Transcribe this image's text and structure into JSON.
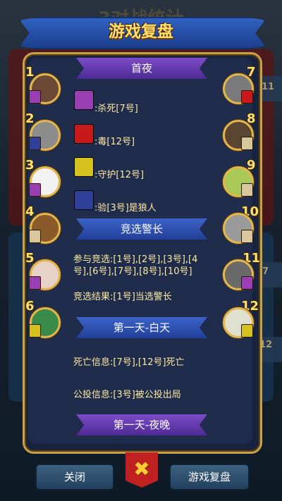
{
  "header": {
    "title": "游戏复盘"
  },
  "backdrop": {
    "title": "3对战统计",
    "side_numbers": [
      "11",
      "7",
      "12"
    ]
  },
  "sections": {
    "night1": "首夜",
    "sheriff": "竞选警长",
    "day1": "第一天-白天",
    "night2": "第一天-夜晚"
  },
  "night_actions": [
    {
      "icon_label": "狼人",
      "text": ":杀死[7号]",
      "color": "#9a3fb3"
    },
    {
      "icon_label": "女巫",
      "text": ":毒[12号]",
      "color": "#c81a1a"
    },
    {
      "icon_label": "守卫",
      "text": ":守护[12号]",
      "color": "#d6c21e"
    },
    {
      "icon_label": "预言家",
      "text": ":验[3号]是狼人",
      "color": "#2f3f9a"
    }
  ],
  "sheriff_lines": {
    "candidates": "参与竞选:[1号],[2号],[3号],[4号],[6号],[7号],[8号],[10号]",
    "candidates_line1": "参与竞选:[1号],[2号],[3号],[4",
    "candidates_line2": "号],[6号],[7号],[8号],[10号]",
    "result": "竞选结果:[1号]当选警长"
  },
  "day1_lines": {
    "death": "死亡信息:[7号],[12号]死亡",
    "vote": "公投信息:[3号]被公投出局"
  },
  "players_left": [
    {
      "num": "1",
      "avatar_color": "#6a4a36",
      "badge_color": "#9a3fb3"
    },
    {
      "num": "2",
      "avatar_color": "#8c8c8c",
      "badge_color": "#2f3f9a"
    },
    {
      "num": "3",
      "avatar_color": "#f2f2f2",
      "badge_color": "#9a3fb3"
    },
    {
      "num": "4",
      "avatar_color": "#8a5a2a",
      "badge_color": "#d8c79a"
    },
    {
      "num": "5",
      "avatar_color": "#e8d2c8",
      "badge_color": "#9a3fb3"
    },
    {
      "num": "6",
      "avatar_color": "#3a8a4a",
      "badge_color": "#d6c21e"
    }
  ],
  "players_right": [
    {
      "num": "7",
      "avatar_color": "#7a7a7a",
      "badge_color": "#c81a1a"
    },
    {
      "num": "8",
      "avatar_color": "#5a4630",
      "badge_color": "#d8c79a"
    },
    {
      "num": "9",
      "avatar_color": "#a8c858",
      "badge_color": "#d8c79a"
    },
    {
      "num": "10",
      "avatar_color": "#9a9a9a",
      "badge_color": "#d8c79a"
    },
    {
      "num": "11",
      "avatar_color": "#6a6a6a",
      "badge_color": "#9a3fb3"
    },
    {
      "num": "12",
      "avatar_color": "#e0e0d0",
      "badge_color": "#d6c21e"
    }
  ],
  "buttons": {
    "close": "关闭",
    "replay": "游戏复盘",
    "x_icon": "✖"
  }
}
